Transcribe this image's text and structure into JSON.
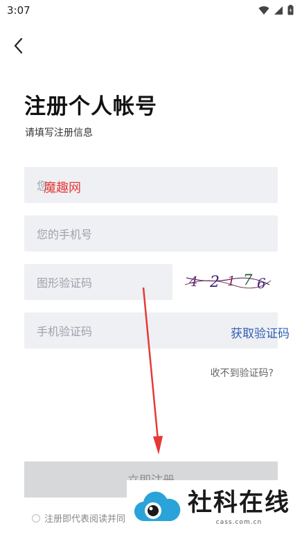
{
  "status_bar": {
    "time": "3:07"
  },
  "header": {
    "title": "注册个人帐号",
    "subtitle": "请填写注册信息"
  },
  "form": {
    "name_placeholder": "您",
    "phone_placeholder": "您的手机号",
    "captcha_placeholder": "图形验证码",
    "captcha_text": "4 2 1 7 6",
    "sms_placeholder": "手机验证码",
    "get_code_label": "获取验证码",
    "no_code_label": "收不到验证码?",
    "register_label": "立即注册",
    "agreement_text": "注册即代表阅读并同"
  },
  "watermarks": {
    "overlay_text": "魔趣网",
    "brand_name": "社科在线",
    "brand_url": "cass.com.cn"
  },
  "colors": {
    "accent": "#2f5fb0",
    "field_bg": "#eff0f4",
    "button_bg": "#d7d8da",
    "arrow": "#e53935"
  }
}
